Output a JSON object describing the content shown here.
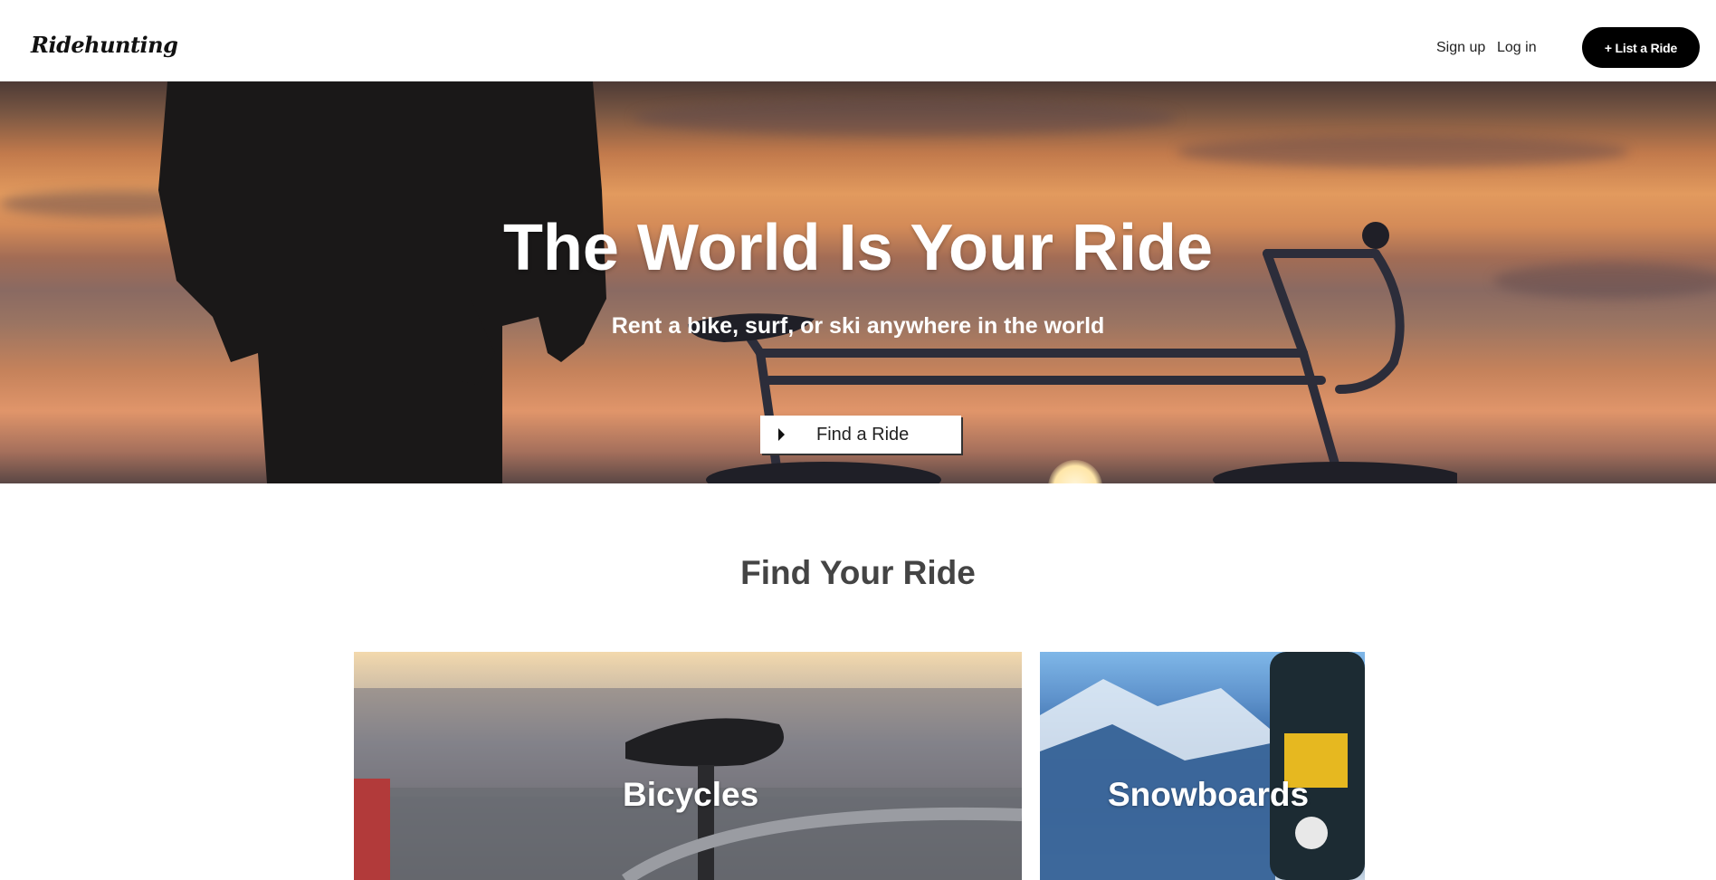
{
  "header": {
    "logo": "Ridehunting",
    "nav": {
      "signup": "Sign up",
      "login": "Log in"
    },
    "list_button": "+ List a Ride"
  },
  "hero": {
    "title": "The World Is Your Ride",
    "subtitle": "Rent a bike, surf, or ski anywhere in the world",
    "cta_label": "Find a Ride"
  },
  "section": {
    "title": "Find Your Ride",
    "cards": [
      {
        "label": "Bicycles"
      },
      {
        "label": "Snowboards"
      }
    ]
  }
}
